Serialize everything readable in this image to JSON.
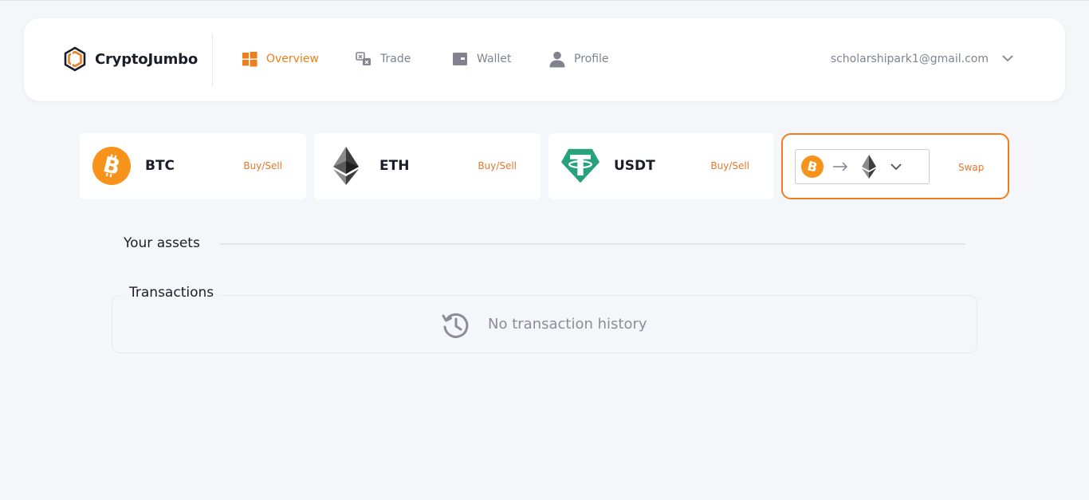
{
  "brand": {
    "name": "CryptoJumbo",
    "logo_icon": "cube-logo-icon"
  },
  "nav": [
    {
      "label": "Overview",
      "icon": "windows-grid-icon",
      "active": true
    },
    {
      "label": "Trade",
      "icon": "exchange-icon",
      "active": false
    },
    {
      "label": "Wallet",
      "icon": "wallet-icon",
      "active": false
    },
    {
      "label": "Profile",
      "icon": "user-icon",
      "active": false
    }
  ],
  "user": {
    "email": "scholarshipark1@gmail.com",
    "menu_icon": "chevron-down-icon"
  },
  "coins": [
    {
      "symbol": "BTC",
      "action": "Buy/Sell",
      "icon": "bitcoin-icon",
      "color": "#f7931a"
    },
    {
      "symbol": "ETH",
      "action": "Buy/Sell",
      "icon": "ethereum-icon",
      "color": "#3c3c3d"
    },
    {
      "symbol": "USDT",
      "action": "Buy/Sell",
      "icon": "tether-icon",
      "color": "#26a17b"
    }
  ],
  "swap": {
    "from_icon": "bitcoin-icon",
    "to_icon": "ethereum-icon",
    "action": "Swap"
  },
  "assets": {
    "title": "Your assets"
  },
  "transactions": {
    "title": "Transactions",
    "empty_text": "No transaction history",
    "empty_icon": "history-icon"
  },
  "colors": {
    "accent": "#f07d1b",
    "background": "#f5f6fa",
    "muted": "#80838f"
  }
}
